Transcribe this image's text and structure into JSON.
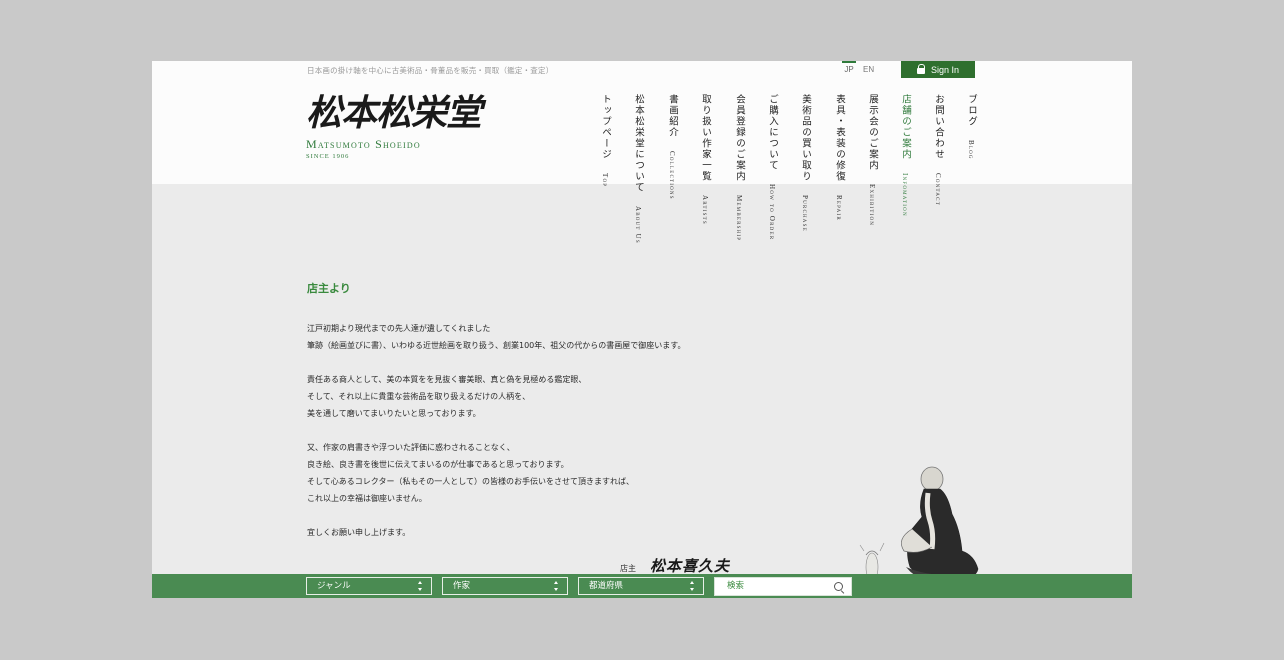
{
  "header": {
    "tagline": "日本画の掛け軸を中心に古美術品・骨董品を販売・買取（鑑定・査定）",
    "lang_jp": "JP",
    "lang_en": "EN",
    "signin_label": "Sign In",
    "logo_kanji": "松本松栄堂",
    "logo_en": "Matsumoto Shoeido",
    "logo_since": "SINCE 1906"
  },
  "nav": [
    {
      "ja": "トップページ",
      "en": "Top",
      "active": false
    },
    {
      "ja": "松本松栄堂について",
      "en": "About Us",
      "active": false
    },
    {
      "ja": "書画紹介",
      "en": "Collections",
      "active": false
    },
    {
      "ja": "取り扱い作家一覧",
      "en": "Artists",
      "active": false
    },
    {
      "ja": "会員登録のご案内",
      "en": "Membership",
      "active": false
    },
    {
      "ja": "ご購入について",
      "en": "How to Order",
      "active": false
    },
    {
      "ja": "美術品の買い取り",
      "en": "Purchase",
      "active": false
    },
    {
      "ja": "表具・表装の修復",
      "en": "Repair",
      "active": false
    },
    {
      "ja": "展示会のご案内",
      "en": "Exhibition",
      "active": false
    },
    {
      "ja": "店舗のご案内",
      "en": "Infomation",
      "active": true
    },
    {
      "ja": "お問い合わせ",
      "en": "Contact",
      "active": false
    },
    {
      "ja": "ブログ",
      "en": "Blog",
      "active": false
    }
  ],
  "content": {
    "title": "店主より",
    "paragraphs": [
      [
        "江戸初期より現代までの先人達が遺してくれました",
        "筆跡（絵画並びに書）、いわゆる近世絵画を取り扱う、創業100年、祖父の代からの書画屋で御座います。"
      ],
      [
        "責任ある商人として、美の本質をを見抜く審美眼、真と偽を見極める鑑定眼、",
        "そして、それ以上に貴重な芸術品を取り扱えるだけの人柄を、",
        "美を通して磨いてまいりたいと思っております。"
      ],
      [
        "又、作家の肩書きや浮ついた評価に惑わされることなく、",
        "良き絵、良き書を後世に伝えてまいるのが仕事であると思っております。",
        "そして心あるコレクター（私もその一人として）の皆様のお手伝いをさせて頂きますれば、",
        "これ以上の幸福は御座いません。"
      ],
      [
        "宜しくお願い申し上げます。"
      ]
    ],
    "signature_label": "店主",
    "signature_name": "松本喜久夫"
  },
  "searchbar": {
    "genre": "ジャンル",
    "artist": "作家",
    "prefecture": "都道府県",
    "search_placeholder": "検索"
  },
  "colors": {
    "accent_green": "#2f7a3b",
    "searchbar_green": "#4a8b52",
    "signin_green": "#2f6f2e"
  }
}
